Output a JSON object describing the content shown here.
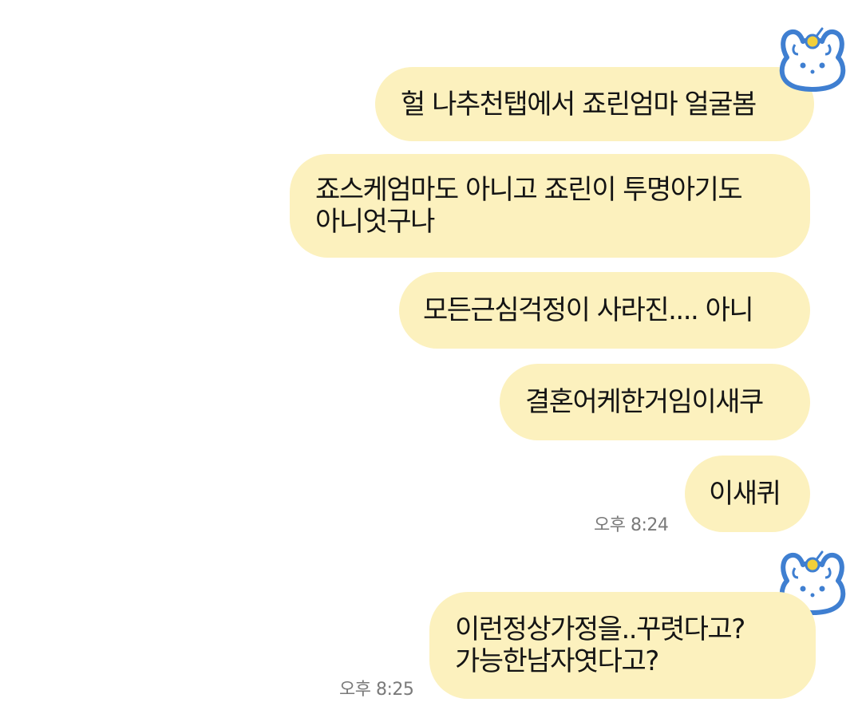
{
  "messages": [
    {
      "text": "헐 나추천탭에서 죠린엄마 얼굴봄"
    },
    {
      "lines": [
        "죠스케엄마도 아니고 죠린이 투명아기도",
        "아니엇구나"
      ]
    },
    {
      "text": "모든근심걱정이 사라진.... 아니"
    },
    {
      "text": "결혼어케한거임이새쿠"
    },
    {
      "text": "이새퀴",
      "time": "오후 8:24"
    },
    {
      "lines": [
        "이런정상가정을..꾸렷다고?",
        "가능한남자엿다고?"
      ],
      "time": "오후 8:25"
    }
  ],
  "colors": {
    "bubble": "#fcf1be",
    "text": "#141414",
    "timestamp": "#7a7a7a",
    "sticker_outline": "#3f7fd1",
    "sticker_flower": "#f2cf3a"
  },
  "icons": {
    "profile_sticker": "cat-with-flower-sticker-icon"
  }
}
